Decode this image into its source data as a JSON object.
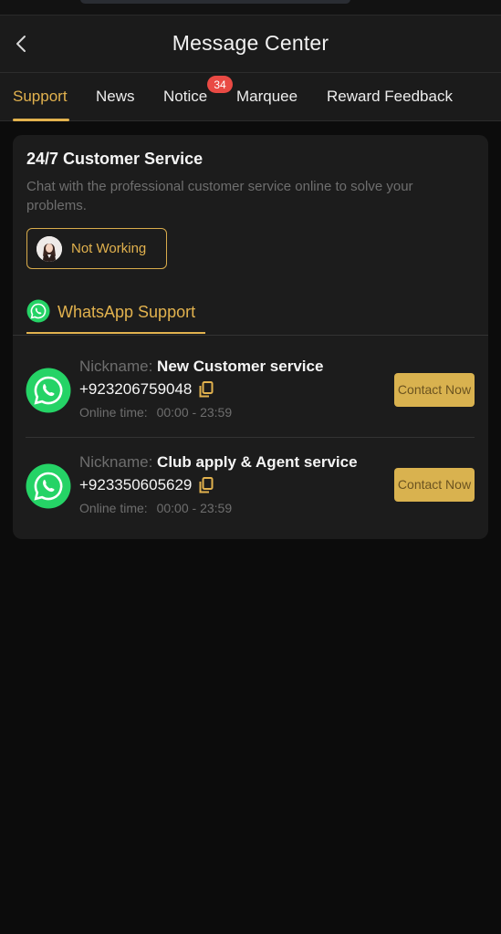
{
  "header": {
    "title": "Message Center",
    "back_icon": "chevron-left-icon"
  },
  "tabs": [
    {
      "label": "Support",
      "active": true
    },
    {
      "label": "News"
    },
    {
      "label": "Notice",
      "badge": "34"
    },
    {
      "label": "Marquee"
    },
    {
      "label": "Reward Feedback"
    }
  ],
  "service": {
    "title": "24/7 Customer Service",
    "description": "Chat with the professional customer service online to solve your problems.",
    "status_label": "Not Working"
  },
  "support_tab": {
    "label": "WhatsApp Support",
    "icon": "whatsapp-icon"
  },
  "contacts": [
    {
      "nickname_label": "Nickname:",
      "nickname": "New Customer service",
      "phone": "+923206759048",
      "online_label": "Online time:",
      "online_time": "00:00 - 23:59",
      "button": "Contact Now"
    },
    {
      "nickname_label": "Nickname:",
      "nickname": "Club apply & Agent service",
      "phone": "+923350605629",
      "online_label": "Online time:",
      "online_time": "00:00 - 23:59",
      "button": "Contact Now"
    }
  ],
  "colors": {
    "accent": "#e2b24e",
    "badge": "#e94a44",
    "whatsapp": "#25d366",
    "background": "#0c0c0c",
    "card": "#1c1c1c"
  }
}
